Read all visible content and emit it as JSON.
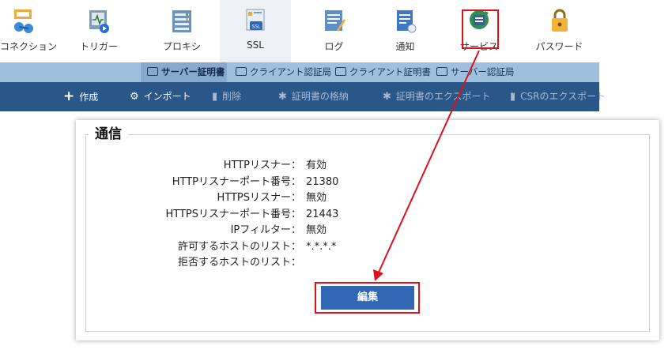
{
  "toolbar": {
    "items": [
      {
        "label": "コネクション",
        "icon": "connection-icon"
      },
      {
        "label": "トリガー",
        "icon": "trigger-icon"
      },
      {
        "label": "プロキシ",
        "icon": "proxy-icon"
      },
      {
        "label": "SSL",
        "icon": "ssl-icon"
      },
      {
        "label": "ログ",
        "icon": "log-icon"
      },
      {
        "label": "通知",
        "icon": "notification-icon"
      },
      {
        "label": "サービス",
        "icon": "service-icon"
      },
      {
        "label": "パスワード",
        "icon": "password-icon"
      }
    ],
    "active": "SSL",
    "highlighted": "サービス"
  },
  "subtabs": [
    {
      "label": "サーバー証明書",
      "active": true
    },
    {
      "label": "クライアント認証局",
      "active": false
    },
    {
      "label": "クライアント証明書",
      "active": false
    },
    {
      "label": "サーバー認証局",
      "active": false
    }
  ],
  "actions": [
    {
      "label": "作成",
      "icon": "plus-icon",
      "enabled": true
    },
    {
      "label": "インポート",
      "icon": "import-icon",
      "enabled": true
    },
    {
      "label": "削除",
      "icon": "trash-icon",
      "enabled": false
    },
    {
      "label": "証明書の格納",
      "icon": "store-cert-icon",
      "enabled": false
    },
    {
      "label": "証明書のエクスポート",
      "icon": "export-cert-icon",
      "enabled": false
    },
    {
      "label": "CSRのエクスポート",
      "icon": "export-csr-icon",
      "enabled": false
    }
  ],
  "panel": {
    "title": "通信",
    "rows": [
      {
        "label": "HTTPリスナー：",
        "value": "有効"
      },
      {
        "label": "HTTPリスナーポート番号：",
        "value": "21380"
      },
      {
        "label": "HTTPSリスナー：",
        "value": "無効"
      },
      {
        "label": "HTTPSリスナーポート番号：",
        "value": "21443"
      },
      {
        "label": "IPフィルター：",
        "value": "無効"
      },
      {
        "label": "許可するホストのリスト：",
        "value": "*.*.*.*"
      },
      {
        "label": "拒否するホストのリスト：",
        "value": ""
      }
    ],
    "edit_label": "編集"
  },
  "colors": {
    "subtab_bg": "#9fbfdf",
    "action_bar_bg": "#2a5688",
    "button_bg": "#2f67b3",
    "highlight": "#e0101b"
  }
}
